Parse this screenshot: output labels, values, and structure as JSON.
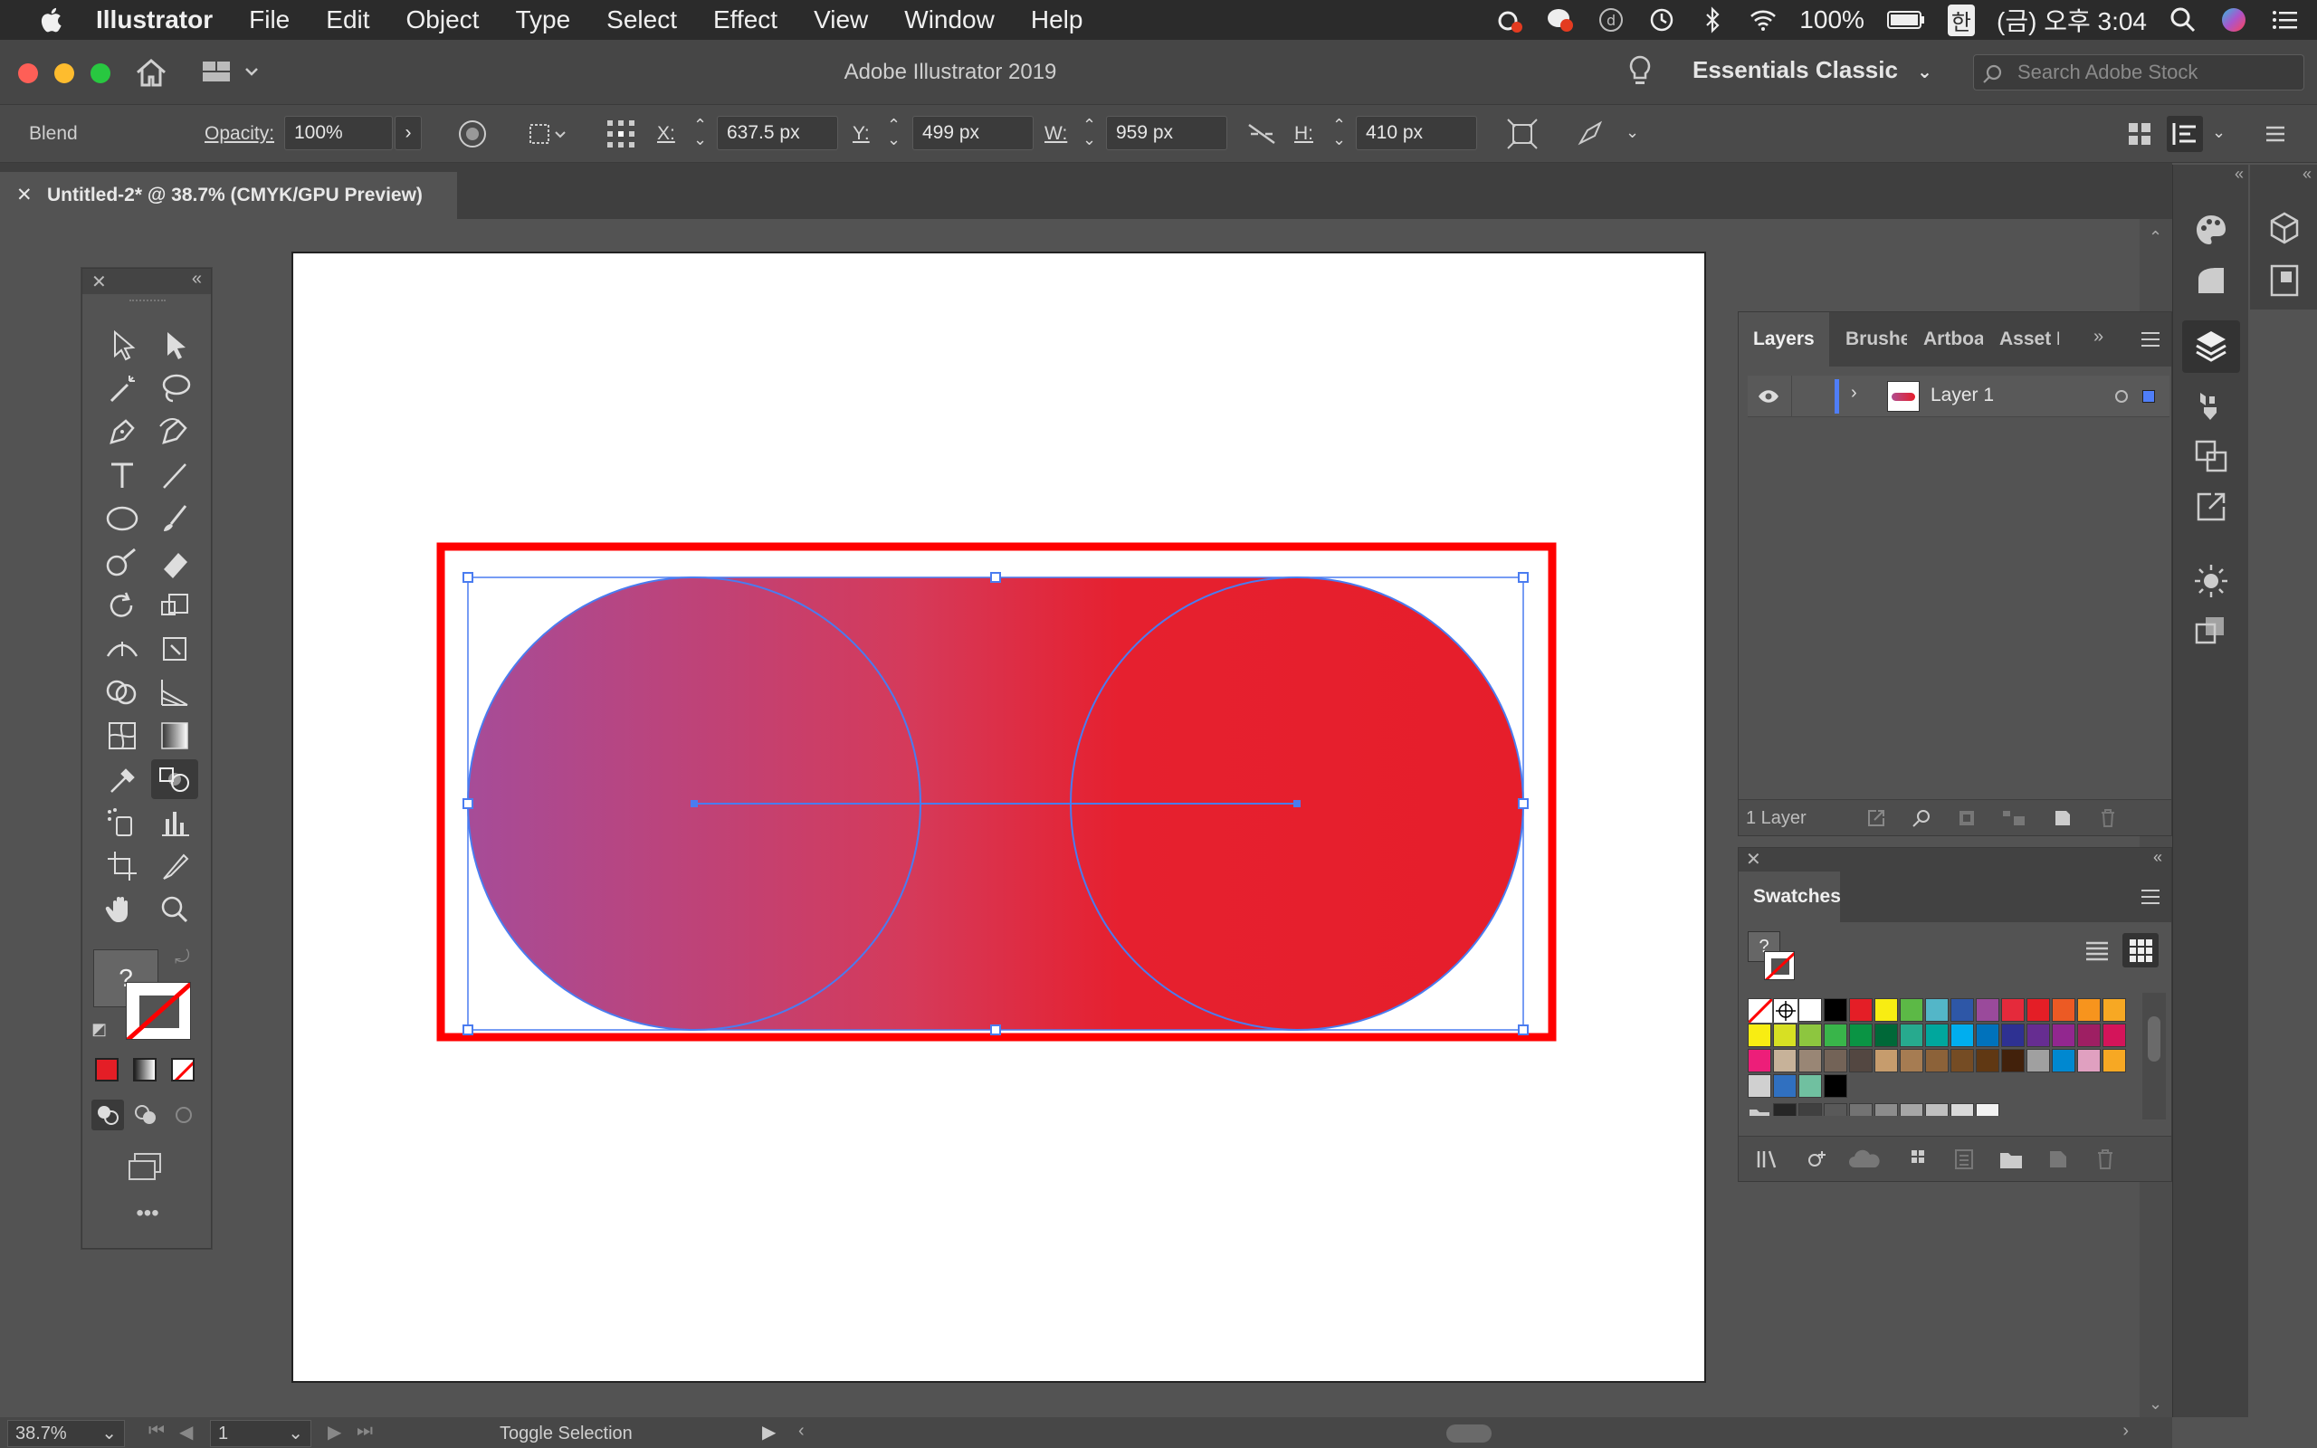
{
  "menubar": {
    "app": "Illustrator",
    "items": [
      "File",
      "Edit",
      "Object",
      "Type",
      "Select",
      "Effect",
      "View",
      "Window",
      "Help"
    ],
    "battery": "100%",
    "input_source": "한",
    "clock": "(금) 오후 3:04"
  },
  "titlebar": {
    "title": "Adobe Illustrator 2019",
    "workspace": "Essentials Classic",
    "search_placeholder": "Search Adobe Stock"
  },
  "controlbar": {
    "selection_type": "Blend",
    "opacity_label": "Opacity:",
    "opacity_value": "100%",
    "x_label": "X:",
    "x_value": "637.5 px",
    "y_label": "Y:",
    "y_value": "499 px",
    "w_label": "W:",
    "w_value": "959 px",
    "h_label": "H:",
    "h_value": "410 px"
  },
  "document": {
    "tab_label": "Untitled-2* @ 38.7% (CMYK/GPU Preview)"
  },
  "tools": {
    "fill_unknown": "?"
  },
  "layers_panel": {
    "tabs": [
      "Layers",
      "Brushe",
      "Artboa",
      "Asset I"
    ],
    "layers": [
      {
        "name": "Layer 1"
      }
    ],
    "count_label": "1 Layer"
  },
  "swatches_panel": {
    "title": "Swatches",
    "fill_unknown": "?",
    "colors": [
      "#ffffff",
      "#000000",
      "#e41e26",
      "#f8ed12",
      "#5cb946",
      "#53b6c8",
      "#2e57a7",
      "#9a4a9b",
      "#e52a3b",
      "#e41e26",
      "#ec5a24",
      "#f7941d",
      "#f7a823",
      "#f8ed12",
      "#d7e023",
      "#8dc63f",
      "#39b54a",
      "#0a9444",
      "#006838",
      "#27aa8e",
      "#00a79d",
      "#00aeef",
      "#0072bc",
      "#2e3192",
      "#662d91",
      "#92278f",
      "#9e1f63",
      "#d4145a",
      "#ed1e79",
      "#c7b299",
      "#998675",
      "#736357",
      "#534741",
      "#c69c6d",
      "#a67c52",
      "#8c6239",
      "#754c24",
      "#603813",
      "#42210b",
      "#a0a0a0",
      "#0088d0",
      "#e0a0c0",
      "#f7a823",
      "#d0d0d0",
      "#3070c0",
      "#70c0a0",
      "#000000",
      "#262626",
      "#404040",
      "#595959",
      "#737373",
      "#8c8c8c",
      "#a6a6a6",
      "#bfbfbf",
      "#d9d9d9",
      "#f2f2f2"
    ]
  },
  "status": {
    "zoom": "38.7%",
    "page": "1",
    "text": "Toggle Selection"
  }
}
